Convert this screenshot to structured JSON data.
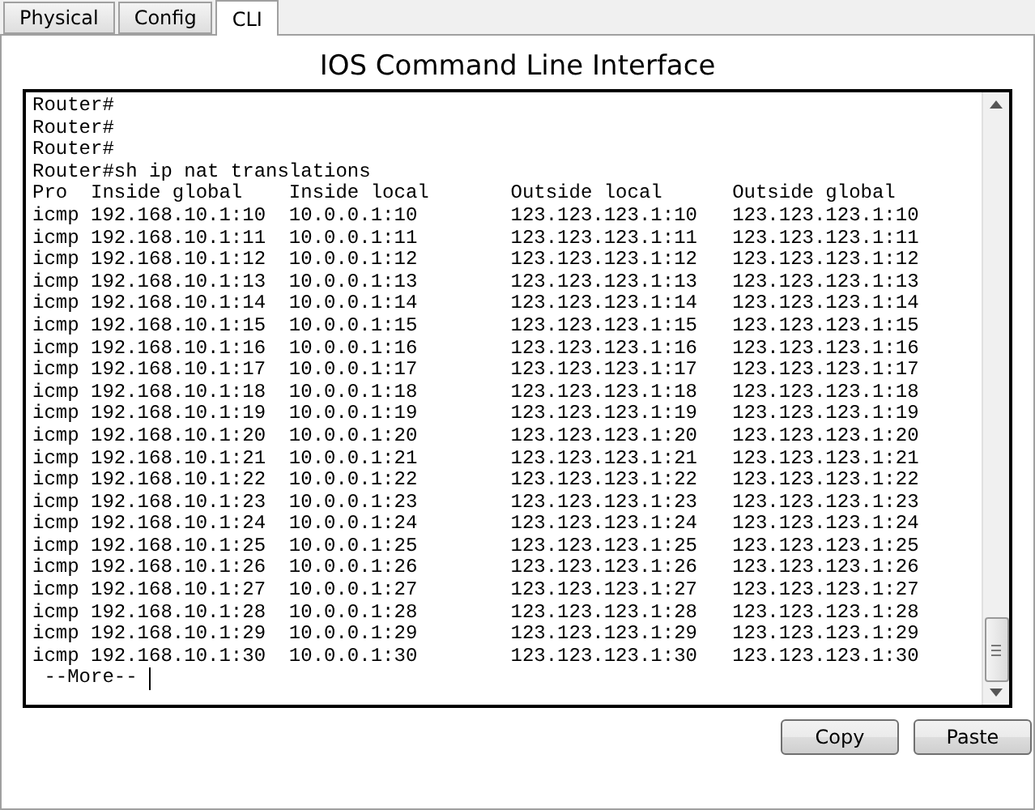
{
  "tabs": [
    {
      "label": "Physical",
      "selected": false
    },
    {
      "label": "Config",
      "selected": false
    },
    {
      "label": "CLI",
      "selected": true
    }
  ],
  "title": "IOS Command Line Interface",
  "terminal": {
    "lines": [
      "Router#",
      "Router#",
      "Router#",
      "Router#sh ip nat translations",
      "Pro  Inside global    Inside local       Outside local      Outside global",
      "icmp 192.168.10.1:10  10.0.0.1:10        123.123.123.1:10   123.123.123.1:10",
      "icmp 192.168.10.1:11  10.0.0.1:11        123.123.123.1:11   123.123.123.1:11",
      "icmp 192.168.10.1:12  10.0.0.1:12        123.123.123.1:12   123.123.123.1:12",
      "icmp 192.168.10.1:13  10.0.0.1:13        123.123.123.1:13   123.123.123.1:13",
      "icmp 192.168.10.1:14  10.0.0.1:14        123.123.123.1:14   123.123.123.1:14",
      "icmp 192.168.10.1:15  10.0.0.1:15        123.123.123.1:15   123.123.123.1:15",
      "icmp 192.168.10.1:16  10.0.0.1:16        123.123.123.1:16   123.123.123.1:16",
      "icmp 192.168.10.1:17  10.0.0.1:17        123.123.123.1:17   123.123.123.1:17",
      "icmp 192.168.10.1:18  10.0.0.1:18        123.123.123.1:18   123.123.123.1:18",
      "icmp 192.168.10.1:19  10.0.0.1:19        123.123.123.1:19   123.123.123.1:19",
      "icmp 192.168.10.1:20  10.0.0.1:20        123.123.123.1:20   123.123.123.1:20",
      "icmp 192.168.10.1:21  10.0.0.1:21        123.123.123.1:21   123.123.123.1:21",
      "icmp 192.168.10.1:22  10.0.0.1:22        123.123.123.1:22   123.123.123.1:22",
      "icmp 192.168.10.1:23  10.0.0.1:23        123.123.123.1:23   123.123.123.1:23",
      "icmp 192.168.10.1:24  10.0.0.1:24        123.123.123.1:24   123.123.123.1:24",
      "icmp 192.168.10.1:25  10.0.0.1:25        123.123.123.1:25   123.123.123.1:25",
      "icmp 192.168.10.1:26  10.0.0.1:26        123.123.123.1:26   123.123.123.1:26",
      "icmp 192.168.10.1:27  10.0.0.1:27        123.123.123.1:27   123.123.123.1:27",
      "icmp 192.168.10.1:28  10.0.0.1:28        123.123.123.1:28   123.123.123.1:28",
      "icmp 192.168.10.1:29  10.0.0.1:29        123.123.123.1:29   123.123.123.1:29",
      "icmp 192.168.10.1:30  10.0.0.1:30        123.123.123.1:30   123.123.123.1:30"
    ],
    "pager": " --More-- "
  },
  "buttons": [
    "Copy",
    "Paste"
  ]
}
